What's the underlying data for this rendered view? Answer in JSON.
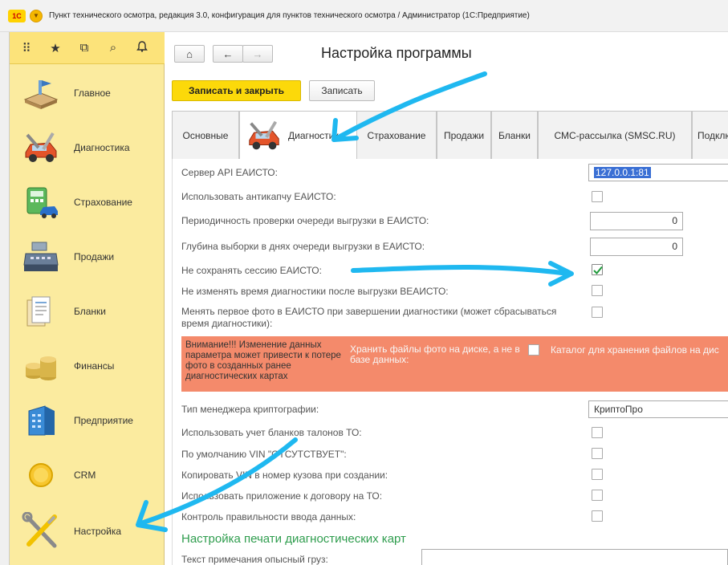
{
  "window": {
    "title": "Пункт технического осмотра, редакция 3.0, конфигурация для пунктов технического осмотра / Администратор  (1С:Предприятие)",
    "logo_text": "1С"
  },
  "left_toolbar": {
    "icons": [
      "apps-grid-icon",
      "star-icon",
      "history-icon",
      "search-icon",
      "bell-icon"
    ],
    "glyphs": [
      "⠿",
      "★",
      "⧉",
      "⌕",
      "♫"
    ]
  },
  "sidebar": {
    "items": [
      {
        "label": "Главное",
        "icon": "home-desk-icon"
      },
      {
        "label": "Диагностика",
        "icon": "car-wrench-icon"
      },
      {
        "label": "Страхование",
        "icon": "calculator-car-icon"
      },
      {
        "label": "Продажи",
        "icon": "cash-register-icon"
      },
      {
        "label": "Бланки",
        "icon": "forms-icon"
      },
      {
        "label": "Финансы",
        "icon": "coins-icon"
      },
      {
        "label": "Предприятие",
        "icon": "building-icon"
      },
      {
        "label": "CRM",
        "icon": "crm-circle-icon"
      },
      {
        "label": "Настройка",
        "icon": "tools-icon"
      }
    ]
  },
  "header": {
    "home": "⌂",
    "back": "←",
    "forward": "→",
    "title": "Настройка программы"
  },
  "actions": {
    "save_close": "Записать и закрыть",
    "save": "Записать"
  },
  "tabs": [
    {
      "label": "Основные",
      "active": false
    },
    {
      "label": "Диагностика",
      "active": true
    },
    {
      "label": "Страхование",
      "active": false
    },
    {
      "label": "Продажи",
      "active": false
    },
    {
      "label": "Бланки",
      "active": false
    },
    {
      "label": "СМС-рассылка (SMSC.RU)",
      "active": false
    },
    {
      "label": "Подклю",
      "active": false
    }
  ],
  "form": {
    "api_server_label": "Сервер API ЕАИСТО:",
    "api_server_value": "127.0.0.1:81",
    "anticaptcha_label": "Использовать антикапчу ЕАИСТО:",
    "queue_period_label": "Периодичность проверки очереди выгрузки в ЕАИСТО:",
    "queue_period_value": "0",
    "queue_depth_label": "Глубина выборки в днях очереди выгрузки в ЕАИСТО:",
    "queue_depth_value": "0",
    "no_session_label": "Не сохранять сессию ЕАИСТО:",
    "no_session_checked": true,
    "no_time_change_label": "Не изменять время диагностики после выгрузки ВЕАИСТО:",
    "change_photo_label_1": "Менять первое фото в ЕАИСТО при завершении диагностики (может сбрасываться",
    "change_photo_label_2": "время диагностики):",
    "warning_text": "Внимание!!! Изменение данных параметра может привести к потере фото в созданных ранее диагностических картах",
    "store_photos_label": "Хранить файлы фото на диске, а не в базе данных:",
    "photo_folder_label": "Каталог для хранения файлов на дис",
    "crypto_label": "Тип менеджера криптографии:",
    "crypto_value": "КриптоПро",
    "use_blanks_label": "Использовать учет бланков талонов ТО:",
    "vin_default_label": "По умолчанию VIN \"ОТСУТСТВУЕТ\":",
    "copy_vin_label": "Копировать VIN в номер кузова при создании:",
    "use_app_label": "Использовать приложение к договору на ТО:",
    "input_control_label": "Контроль правильности ввода данных:",
    "print_section_title": "Настройка печати диагностических карт",
    "note_label": "Текст примечания опысный груз:"
  },
  "colors": {
    "accent_yellow": "#fcd90a",
    "sidebar_bg": "#fbeb9f",
    "warning_bg": "#f48a6b",
    "section_green": "#2f9d4e",
    "annotation_blue": "#1fb8f0"
  }
}
